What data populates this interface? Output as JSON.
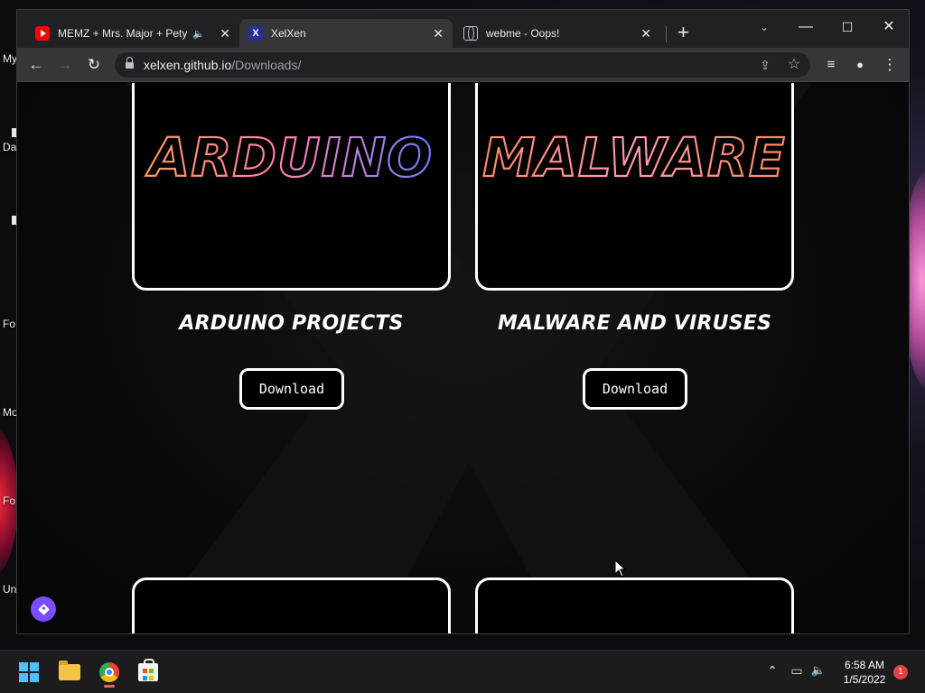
{
  "desktop": {
    "labels": [
      {
        "id": "my",
        "text": "My"
      },
      {
        "id": "da",
        "text": "Da"
      },
      {
        "id": "fo1",
        "text": "Fo"
      },
      {
        "id": "mo",
        "text": "Mo"
      },
      {
        "id": "fo2",
        "text": "Fo"
      },
      {
        "id": "un",
        "text": "Un"
      }
    ]
  },
  "browser": {
    "tabs": [
      {
        "title": "MEMZ + Mrs. Major + Petya",
        "favicon": "youtube-icon",
        "audio": "speaker-icon",
        "active": false
      },
      {
        "title": "XelXen",
        "favicon": "xelxen-icon",
        "active": true
      },
      {
        "title": "webme - Oops!",
        "favicon": "globe-icon",
        "active": false
      }
    ],
    "new_tab_glyph": "+",
    "close_glyph": "✕",
    "window_controls": {
      "tab_search": "⌄",
      "minimize": "—",
      "maximize": "☐",
      "close": "✕"
    },
    "toolbar": {
      "back": "←",
      "forward": "→",
      "reload": "↻",
      "url_host": "xelxen.github.io",
      "url_path": "/Downloads/",
      "share": "⇪",
      "bookmark": "☆",
      "media": "≡",
      "profile": "●",
      "menu": "⋮"
    }
  },
  "page": {
    "cards": [
      {
        "art_text": "ARDUINO",
        "title": "ARDUINO PROJECTS",
        "button": "Download"
      },
      {
        "art_text": "MALWARE",
        "title": "MALWARE AND VIRUSES",
        "button": "Download"
      }
    ],
    "colors": {
      "accent_pink": "#ff7eb3",
      "accent_orange": "#ff9a5a",
      "accent_blue": "#6a7dff",
      "discord": "#7a4dff"
    }
  },
  "taskbar": {
    "apps": [
      "start-icon",
      "file-explorer-icon",
      "chrome-icon",
      "store-icon"
    ],
    "tray": {
      "overflow": "⌃",
      "network": "▭",
      "volume": "🔈"
    },
    "time": "6:58 AM",
    "date": "1/5/2022",
    "notifications": "1"
  }
}
